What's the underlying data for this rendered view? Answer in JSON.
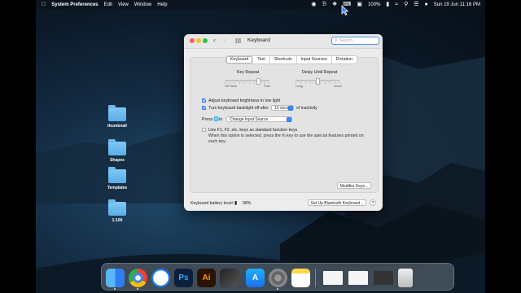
{
  "menubar": {
    "apple_icon": "apple-logo",
    "app_name": "System Preferences",
    "menus": [
      "Edit",
      "View",
      "Window",
      "Help"
    ],
    "battery_percent": "100%",
    "datetime": "Sun 19 Jun  11:16 PM"
  },
  "desktop": {
    "folders": [
      "thumbnail",
      "Shapes",
      "Templates",
      "1-100"
    ]
  },
  "window": {
    "title": "Keyboard",
    "search_placeholder": "Search",
    "tabs": [
      "Keyboard",
      "Text",
      "Shortcuts",
      "Input Sources",
      "Dictation"
    ],
    "active_tab": "Keyboard",
    "key_repeat": {
      "label": "Key Repeat",
      "min_labels": "Off  Slow",
      "max_label": "Fast",
      "value": 0.78
    },
    "delay_until_repeat": {
      "label": "Delay Until Repeat",
      "min_label": "Long",
      "max_label": "Short",
      "value": 0.5
    },
    "adjust_brightness": {
      "label": "Adjust keyboard brightness in low light",
      "checked": true
    },
    "backlight_off": {
      "label_before": "Turn keyboard backlight off after",
      "value": "10 secs",
      "label_after": "of inactivity",
      "checked": true
    },
    "press_globe": {
      "label_before": "Press",
      "globe_icon": "globe-icon",
      "label_to": "to",
      "value": "Change Input Source"
    },
    "function_keys": {
      "label": "Use F1, F2, etc. keys as standard function keys",
      "description": "When this option is selected, press the fn key to use the special features printed on each key.",
      "checked": false
    },
    "modifier_keys_button": "Modifier Keys...",
    "battery_label": "Keyboard battery level:",
    "battery_value": "98%",
    "bluetooth_button": "Set Up Bluetooth Keyboard...",
    "help_button": "?"
  },
  "dock": {
    "apps": [
      "Finder",
      "Chrome",
      "Safari",
      "Photoshop",
      "Illustrator",
      "Final Cut Pro",
      "App Store",
      "System Preferences",
      "Notes"
    ],
    "ps_text": "Ps",
    "ai_text": "Ai",
    "colors": {
      "photoshop": "#0c1f3b",
      "illustrator": "#2a1300",
      "accent": "#2f7ef0"
    }
  }
}
